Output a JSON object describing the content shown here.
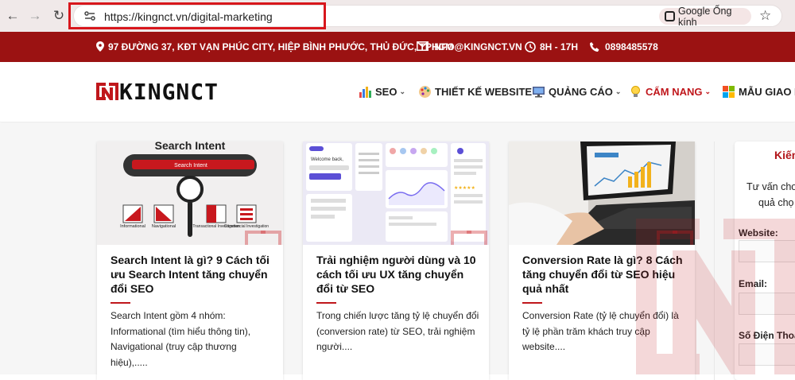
{
  "browser": {
    "url": "https://kingnct.vn/digital-marketing",
    "lens_label": "Google Ống kính"
  },
  "topbar": {
    "address": "97 ĐƯỜNG 37, KĐT VẠN PHÚC CITY, HIỆP BÌNH PHƯỚC, THỦ ĐỨC, TPHCM",
    "email": "INFO@KINGNCT.VN",
    "hours": "8H - 17H",
    "phone": "0898485578"
  },
  "header": {
    "logo": "KINGNCT",
    "menu": [
      {
        "label": "SEO",
        "icon": "chart-icon",
        "dropdown": true
      },
      {
        "label": "THIẾT KẾ WEBSITE",
        "icon": "palette-icon",
        "dropdown": false
      },
      {
        "label": "QUẢNG CÁO",
        "icon": "monitor-icon",
        "dropdown": true
      },
      {
        "label": "CẨM NANG",
        "icon": "lightbulb-icon",
        "dropdown": true
      },
      {
        "label": "MẪU GIAO D",
        "icon": "windows-icon",
        "dropdown": false
      }
    ],
    "active_color": "#c0171c"
  },
  "thumb1": {
    "heading": "Search Intent",
    "bar": "Search Intent",
    "labels": [
      "Informational",
      "Navigational",
      "Transactional Investigation",
      "Commercial Investigation"
    ]
  },
  "thumb2": {
    "welcome": "Welcome back,"
  },
  "cards": [
    {
      "title": "Search Intent là gì? 9 Cách tối ưu Search Intent tăng chuyển đổi SEO",
      "excerpt": "Search Intent gồm 4 nhóm: Informational (tìm hiểu thông tin), Navigational (truy cập thương hiệu),....."
    },
    {
      "title": "Trải nghiệm người dùng và 10 cách tối ưu UX tăng chuyển đổi từ SEO",
      "excerpt": "Trong chiến lược tăng tỷ lệ chuyển đổi (conversion rate) từ SEO, trải nghiệm người...."
    },
    {
      "title": "Conversion Rate là gì? 8 Cách tăng chuyển đổi từ SEO hiệu quả nhất",
      "excerpt": "Conversion Rate (tỷ lệ chuyển đổi) là tỷ lệ phần trăm khách truy cập website...."
    }
  ],
  "sidebar": {
    "title": "Kiến",
    "desc_line1": "Tư vấn cho",
    "desc_line2": "quả chọ",
    "website_label": "Website:",
    "email_label": "Email:",
    "phone_label": "Số Điện Thoạ"
  },
  "colors": {
    "brand_red": "#9b1212",
    "accent": "#c0171c"
  }
}
